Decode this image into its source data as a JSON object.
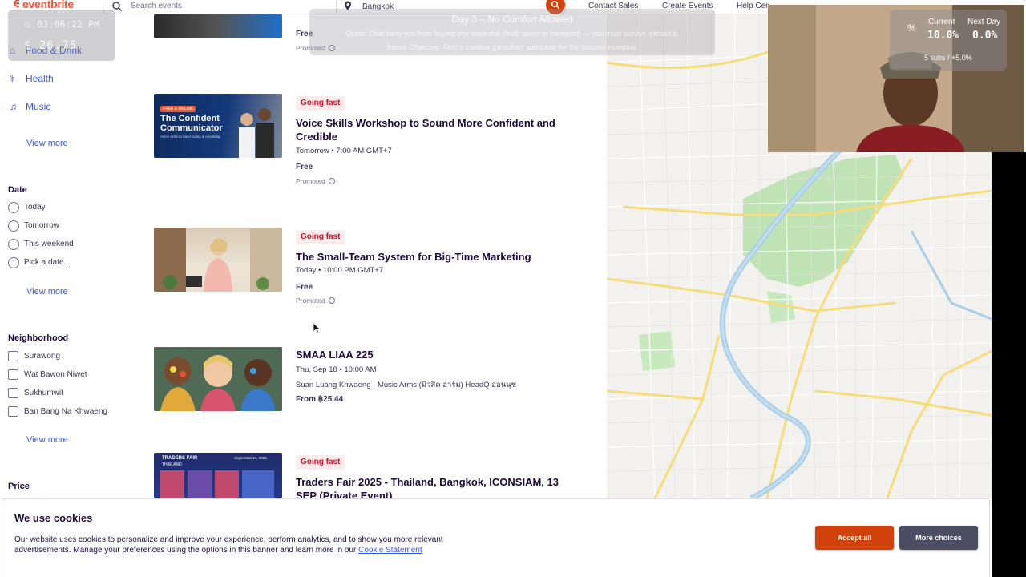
{
  "header": {
    "logo_text": "eventbrite",
    "search_placeholder": "Search events",
    "location": "Bangkok",
    "nav": [
      "Contact Sales",
      "Create Events",
      "Help Cen"
    ]
  },
  "overlay": {
    "timer_time": "03:06:22 PM",
    "timer_money": "$ 26.75",
    "challenge_title": "Day 3 – No Comfort Allowed",
    "challenge_quest": "Quest: Chat bans you from buying one essential (food, water or transport) — you must survive without it.",
    "challenge_bonus": "Bonus Objective: Find a creative (possible) substitute for the banned essential.",
    "stats_current_label": "Current",
    "stats_current_value": "10.0%",
    "stats_next_label": "Next Day",
    "stats_next_value": "0.0%",
    "stats_sub": "5 subs / +5.0%"
  },
  "sidebar": {
    "categories": [
      "Food & Drink",
      "Health",
      "Music"
    ],
    "view_more": "View more",
    "date_heading": "Date",
    "date_options": [
      "Today",
      "Tomorrow",
      "This weekend",
      "Pick a date..."
    ],
    "neighborhood_heading": "Neighborhood",
    "neighborhoods": [
      "Surawong",
      "Wat Bawon Niwet",
      "Sukhumwit",
      "Ban Bang Na Khwaeng"
    ],
    "price_heading": "Price"
  },
  "events": [
    {
      "title": "",
      "price": "Free",
      "promoted": "Promoted"
    },
    {
      "badge": "Going fast",
      "title": "Voice Skills Workshop to Sound More Confident and Credible",
      "date": "Tomorrow • 7:00 AM GMT+7",
      "price": "Free",
      "promoted": "Promoted",
      "thumb_text_small": "FREE & ONLINE",
      "thumb_text_big": "The Confident Communicator",
      "thumb_text_tag": "Voice skills to build clarity & credibility"
    },
    {
      "badge": "Going fast",
      "title": "The Small-Team System for Big-Time Marketing",
      "date": "Today • 10:00 PM GMT+7",
      "price": "Free",
      "promoted": "Promoted"
    },
    {
      "title": "SMAA LIAA 225",
      "date": "Thu, Sep 18 • 10:00 AM",
      "venue": "Suan Luang Khwaeng · Music Arms (มิวสิค อาร์ม) HeadQ อ่อนนุช",
      "price": "From ฿25.44"
    },
    {
      "badge": "Going fast",
      "title": "Traders Fair 2025 - Thailand, Bangkok, ICONSIAM, 13 SEP (Private Event)",
      "thumb_text_small": "TRADERS FAIR",
      "thumb_text_big": "THAILAND",
      "thumb_date": "September 13, 2025"
    }
  ],
  "cookie": {
    "title": "We use cookies",
    "text": "Our website uses cookies to personalize and improve your experience, perform analytics, and to show you more relevant advertisements. Manage your preferences using the options in this banner and learn more in our",
    "link": "Cookie Statement",
    "accept": "Accept all",
    "more": "More choices"
  },
  "colors": {
    "brand": "#f05537",
    "accent_blue": "#3659e3",
    "badge_bg": "#fdeceb",
    "badge_text": "#c5162e",
    "accept_btn": "#d1410c",
    "more_btn": "#4b4d63"
  }
}
